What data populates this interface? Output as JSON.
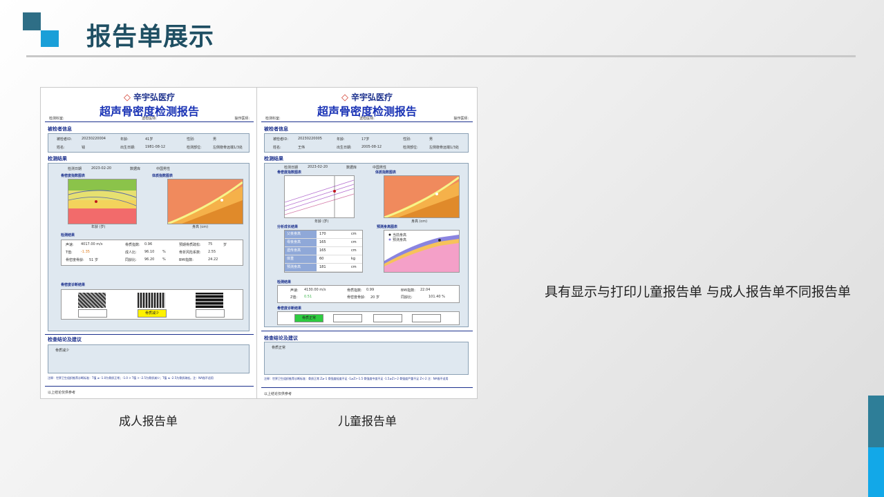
{
  "slide": {
    "title": "报告单展示",
    "description": "具有显示与打印儿童报告单 与成人报告单不同报告单"
  },
  "reports": [
    {
      "caption": "成人报告单",
      "hospital": "辛宇弘医疗",
      "report_title": "超声骨密度检测报告",
      "meta": {
        "dept": "检测科室:",
        "doctor": "送检医师:",
        "operator": "操作医师:"
      },
      "section_patient": "被检者信息",
      "patient": {
        "id_label": "被检者ID:",
        "id": "20230220004",
        "age_label": "年龄:",
        "age": "41岁",
        "sex_label": "性别:",
        "sex": "男",
        "name_label": "姓名:",
        "name": "钱",
        "dob_label": "出生日期:",
        "dob": "1981-08-12",
        "site_label": "检测部位:",
        "site": "左侧桡骨远端1/3处"
      },
      "section_result": "检测结果",
      "test_date_label": "检测日期",
      "test_date": "2023-02-20",
      "db_label": "数据库",
      "db": "中国男性",
      "chart1_title": "骨密度指数图表",
      "chart1_xlabel": "年龄 (岁)",
      "chart2_title": "体质指数图表",
      "chart2_xlabel": "身高 (cm)",
      "results_title": "检测结果",
      "results": {
        "sos_label": "声速:",
        "sos": "4017.00 m/s",
        "bqi_label": "骨质指数:",
        "bqi": "0.96",
        "peak_label": "预期骨质疏松:",
        "peak": "75",
        "peak_unit": "岁",
        "t_label": "T值:",
        "t": "-1.35",
        "adult_label": "成人比:",
        "adult": "96.10",
        "adult_unit": "%",
        "risk_label": "骨折风险系数:",
        "risk": "2.55",
        "bone_age_label": "骨密度骨龄:",
        "bone_age": "51 岁",
        "peer_label": "同龄比:",
        "peer": "96.20",
        "peer_unit": "%",
        "bmi_label": "BMI指数:",
        "bmi": "24.22"
      },
      "diag_title": "骨密度诊断结果",
      "diag_label": "骨质减少",
      "section_conclusion": "检查结论及建议",
      "conclusion": "骨质减少",
      "note": "注释：世界卫生组织推荐诊断标准：T值 ≥ -1.0为骨质正常；-1.0 > T值 > -2.5为骨质减少；T值 ≤ -2.5为骨质疏松。注：NA指不适用",
      "footer": "以上结论仅供参考"
    },
    {
      "caption": "儿童报告单",
      "hospital": "辛宇弘医疗",
      "report_title": "超声骨密度检测报告",
      "meta": {
        "dept": "检测科室:",
        "doctor": "送检医师:",
        "operator": "操作医师:"
      },
      "section_patient": "被检者信息",
      "patient": {
        "id_label": "被检者ID:",
        "id": "20230220005",
        "age_label": "年龄:",
        "age": "17岁",
        "sex_label": "性别:",
        "sex": "男",
        "name_label": "姓名:",
        "name": "王伟",
        "dob_label": "出生日期:",
        "dob": "2005-08-12",
        "site_label": "检测部位:",
        "site": "左侧桡骨远端1/3处"
      },
      "section_result": "检测结果",
      "test_date_label": "检测日期",
      "test_date": "2023-02-20",
      "db_label": "数据库",
      "db": "中国男性",
      "chart1_title": "骨密度指数图表",
      "chart1_xlabel": "年龄 (岁)",
      "chart2_title": "体质指数图表",
      "chart2_xlabel": "身高 (cm)",
      "growth_title": "分析成长结果",
      "growth_rows": [
        {
          "label": "父亲身高",
          "value": "170",
          "unit": "cm"
        },
        {
          "label": "母亲身高",
          "value": "165",
          "unit": "cm"
        },
        {
          "label": "遗传身高",
          "value": "165",
          "unit": "cm"
        },
        {
          "label": "体重",
          "value": "60",
          "unit": "kg"
        },
        {
          "label": "预测身高",
          "value": "181",
          "unit": "cm"
        }
      ],
      "predict_title": "预测身高图表",
      "predict_legend": [
        "当前身高",
        "预测身高"
      ],
      "results_title": "检测结果",
      "results": {
        "sos_label": "声速:",
        "sos": "4130.00 m/s",
        "bqi_label": "骨质指数:",
        "bqi": "0.99",
        "bmi_label": "BMI指数:",
        "bmi": "22.04",
        "z_label": "Z值:",
        "z": "0.51",
        "bone_age_label": "骨密度骨龄:",
        "bone_age": "20 岁",
        "peer_label": "同龄比:",
        "peer": "101.40 %"
      },
      "diag_title": "骨密度诊断结果",
      "diag_label": "骨质正常",
      "section_conclusion": "检查结论及建议",
      "conclusion": "骨质正常",
      "note": "注释：世界卫生组织推荐诊断标准：骨质正常 Z≥-1 骨强度轻度不足 -1≥Z>-1.5 骨强度中度不足 -1.5≥Z>-2 骨强度严重不足 Z<-2 注：NA指不适用",
      "footer": "以上结论仅供参考"
    }
  ],
  "colors": {
    "title": "#1f4f63",
    "accent_dark": "#2e6e86",
    "accent_light": "#1a9fd8",
    "report_blue": "#1a33b5"
  }
}
